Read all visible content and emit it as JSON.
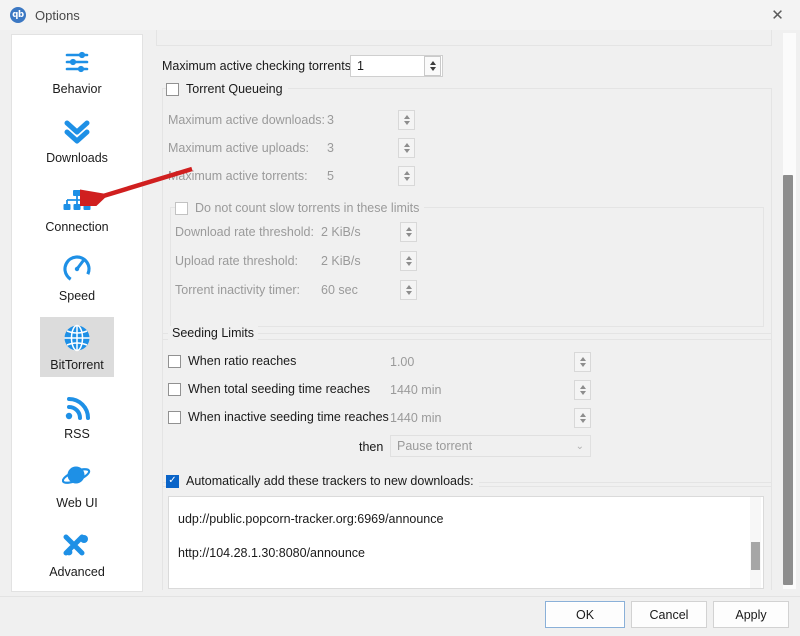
{
  "window": {
    "title": "Options",
    "logo_text": "qb",
    "close_icon": "✕"
  },
  "sidebar": {
    "items": [
      {
        "label": "Behavior",
        "icon": "sliders-icon",
        "selected": false
      },
      {
        "label": "Downloads",
        "icon": "double-chevron-down-icon",
        "selected": false
      },
      {
        "label": "Connection",
        "icon": "network-tree-icon",
        "selected": false
      },
      {
        "label": "Speed",
        "icon": "speedometer-icon",
        "selected": false
      },
      {
        "label": "BitTorrent",
        "icon": "globe-icon",
        "selected": true
      },
      {
        "label": "RSS",
        "icon": "rss-icon",
        "selected": false
      },
      {
        "label": "Web UI",
        "icon": "planet-icon",
        "selected": false
      },
      {
        "label": "Advanced",
        "icon": "tools-icon",
        "selected": false
      }
    ]
  },
  "main": {
    "max_checking": {
      "label": "Maximum active checking torrents:",
      "value": "1"
    },
    "queueing": {
      "group_label": "Torrent Queueing",
      "checked": false,
      "rows": [
        {
          "label": "Maximum active downloads:",
          "value": "3"
        },
        {
          "label": "Maximum active uploads:",
          "value": "3"
        },
        {
          "label": "Maximum active torrents:",
          "value": "5"
        }
      ],
      "slow": {
        "group_label": "Do not count slow torrents in these limits",
        "checked": false,
        "rows": [
          {
            "label": "Download rate threshold:",
            "value": "2 KiB/s"
          },
          {
            "label": "Upload rate threshold:",
            "value": "2 KiB/s"
          },
          {
            "label": "Torrent inactivity timer:",
            "value": "60 sec"
          }
        ]
      }
    },
    "seeding": {
      "group_label": "Seeding Limits",
      "rows": [
        {
          "label": "When ratio reaches",
          "value": "1.00",
          "checked": false
        },
        {
          "label": "When total seeding time reaches",
          "value": "1440 min",
          "checked": false
        },
        {
          "label": "When inactive seeding time reaches",
          "value": "1440 min",
          "checked": false
        }
      ],
      "then_label": "then",
      "then_value": "Pause torrent",
      "chevron": "⌄"
    },
    "trackers": {
      "group_label": "Automatically add these trackers to new downloads:",
      "checked": true,
      "check_glyph": "✓",
      "lines": [
        "udp://public.popcorn-tracker.org:6969/announce",
        "http://104.28.1.30:8080/announce"
      ]
    }
  },
  "buttons": {
    "ok": "OK",
    "cancel": "Cancel",
    "apply": "Apply"
  },
  "annotation": {
    "arrow_color": "#d01f1f",
    "points_to": "sidebar-item-connection"
  },
  "colors": {
    "accent": "#1e90e6",
    "checkbox_checked": "#0a64c8",
    "dialog_bg": "#f0f0f0"
  }
}
